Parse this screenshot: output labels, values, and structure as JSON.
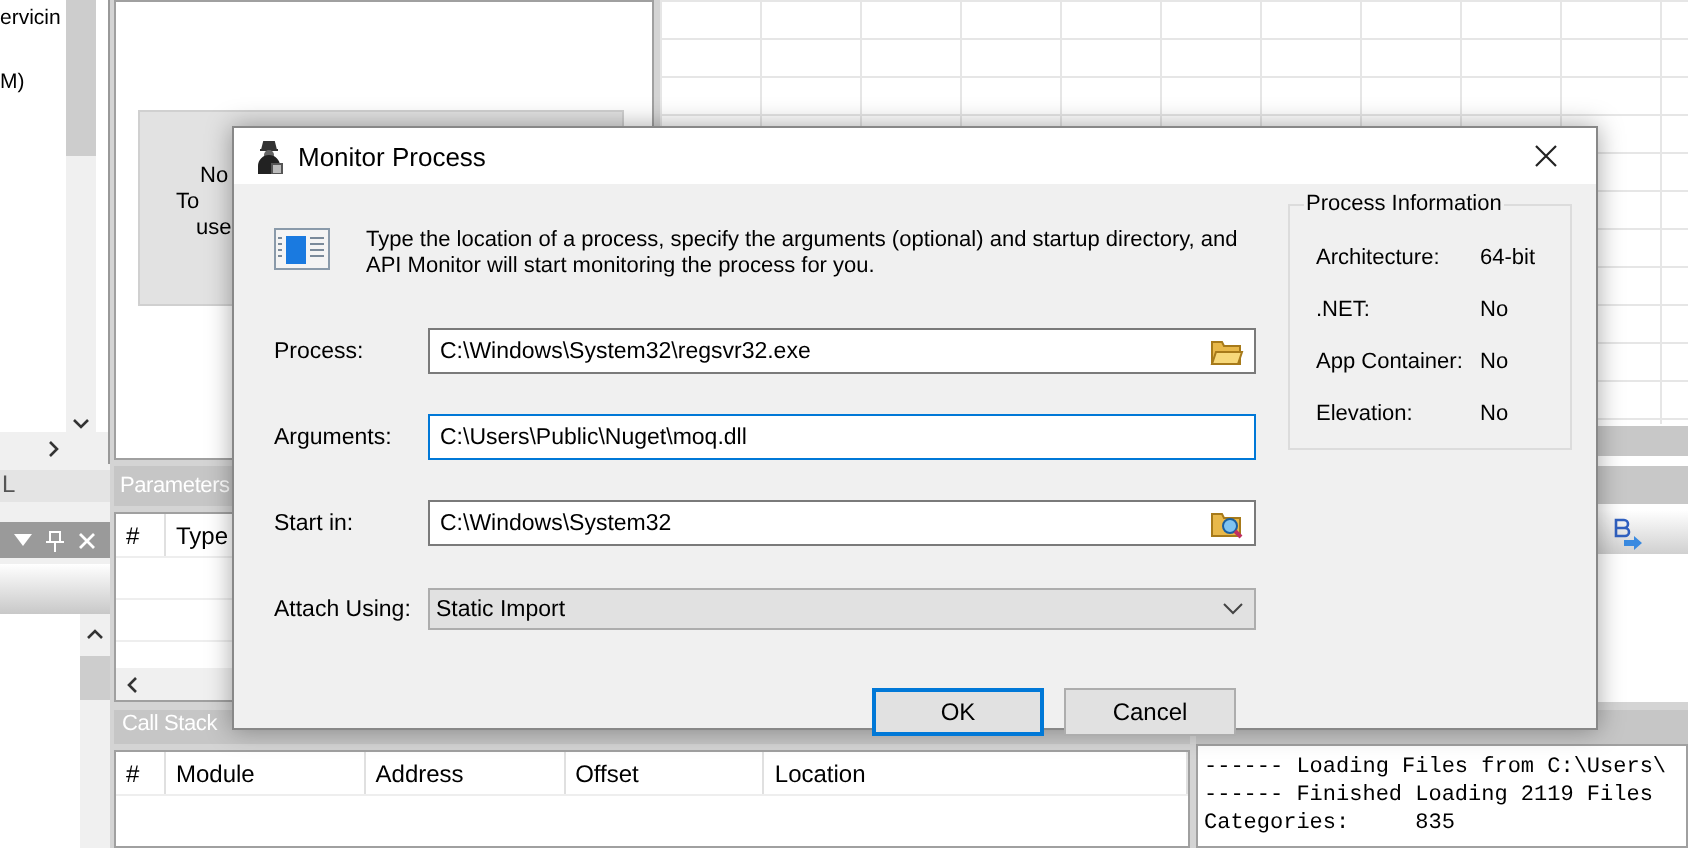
{
  "left_panel": {
    "items": [
      "ervicin",
      "M)"
    ],
    "header": "L"
  },
  "top_panel": {
    "notice_lines": [
      "No",
      "To",
      "use"
    ]
  },
  "parameters": {
    "title": "Parameters",
    "columns": [
      "#",
      "Type"
    ]
  },
  "call_stack": {
    "title": "Call Stack",
    "columns": [
      "#",
      "Module",
      "Address",
      "Offset",
      "Location"
    ]
  },
  "output": {
    "lines": [
      "------ Loading Files from C:\\Users\\",
      "------ Finished Loading 2119 Files",
      "Categories:     835"
    ]
  },
  "dialog": {
    "title": "Monitor Process",
    "description": "Type the location of a process, specify the arguments (optional) and startup directory, and API Monitor will start monitoring the process for you.",
    "fields": [
      {
        "kind": "browse",
        "label": "Process:",
        "value": "C:\\Windows\\System32\\regsvr32.exe",
        "focused": false
      },
      {
        "kind": "text",
        "label": "Arguments:",
        "value": "C:\\Users\\Public\\Nuget\\moq.dll",
        "focused": true
      },
      {
        "kind": "folder",
        "label": "Start in:",
        "value": "C:\\Windows\\System32",
        "focused": false
      },
      {
        "kind": "dropdown",
        "label": "Attach Using:",
        "value": "Static Import",
        "focused": false
      }
    ],
    "info": {
      "title": "Process Information",
      "rows": [
        {
          "label": "Architecture:",
          "value": "64-bit"
        },
        {
          "label": ".NET:",
          "value": "No"
        },
        {
          "label": "App Container:",
          "value": "No"
        },
        {
          "label": "Elevation:",
          "value": "No"
        }
      ]
    },
    "buttons": [
      {
        "label": "OK",
        "default": true
      },
      {
        "label": "Cancel",
        "default": false
      }
    ]
  }
}
